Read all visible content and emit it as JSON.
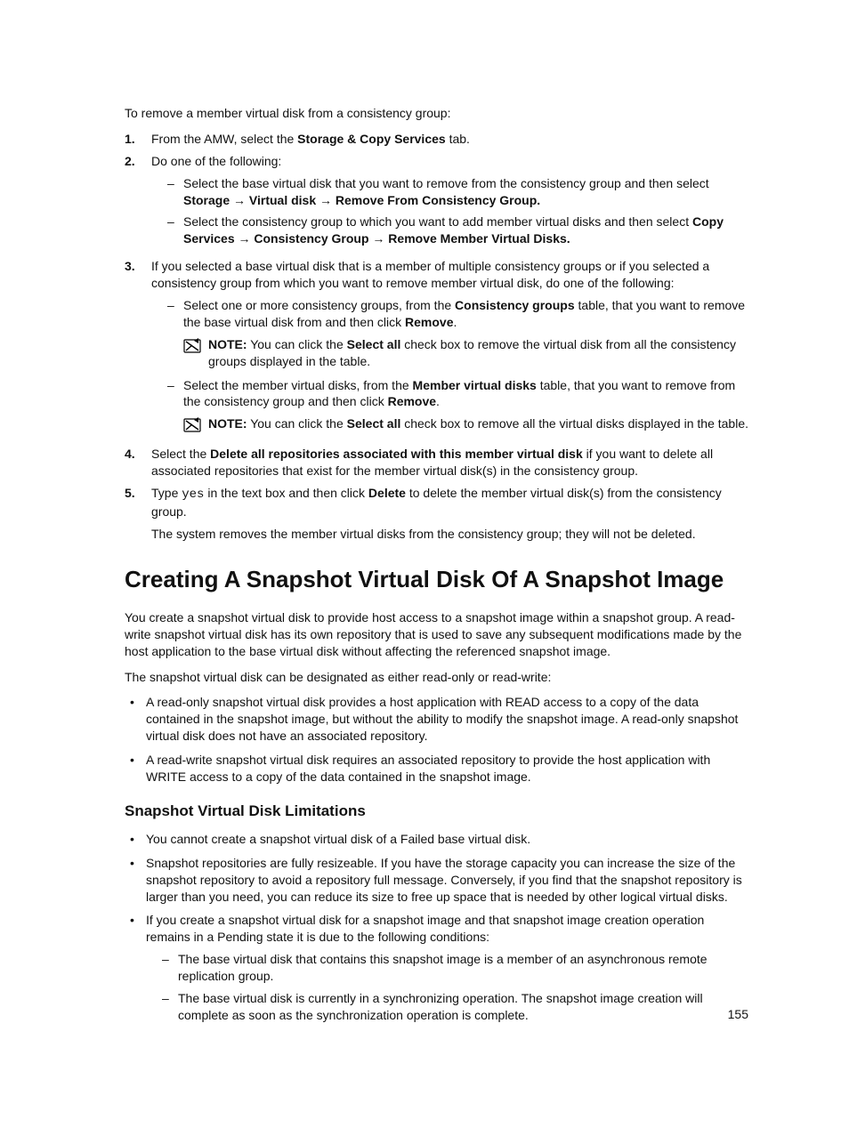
{
  "intro": "To remove a member virtual disk from a consistency group:",
  "steps": {
    "s1": {
      "num": "1.",
      "pre": "From the AMW, select the ",
      "bold": "Storage & Copy Services",
      "post": " tab."
    },
    "s2": {
      "num": "2.",
      "text": "Do one of the following:",
      "a": {
        "pre": "Select the base virtual disk that you want to remove from the consistency group and then select ",
        "bold": "Storage → Virtual disk → Remove From Consistency Group."
      },
      "b": {
        "pre": "Select the consistency group to which you want to add member virtual disks and then select ",
        "bold": "Copy Services → Consistency Group → Remove Member Virtual Disks."
      }
    },
    "s3": {
      "num": "3.",
      "text": "If you selected a base virtual disk that is a member of multiple consistency groups or if you selected a consistency group from which you want to remove member virtual disk, do one of the following:",
      "a": {
        "p1": "Select one or more consistency groups, from the ",
        "b1": "Consistency groups",
        "p2": " table, that you want to remove the base virtual disk from and then click ",
        "b2": "Remove",
        "p3": "."
      },
      "note_a": {
        "label": "NOTE:",
        "p1": " You can click the ",
        "b1": "Select all",
        "p2": " check box to remove the virtual disk from all the consistency groups displayed in the table."
      },
      "b": {
        "p1": "Select the member virtual disks, from the ",
        "b1": "Member virtual disks",
        "p2": " table, that you want to remove from the consistency group and then click ",
        "b2": "Remove",
        "p3": "."
      },
      "note_b": {
        "label": "NOTE:",
        "p1": " You can click the ",
        "b1": "Select all",
        "p2": " check box to remove all the virtual disks displayed in the table."
      }
    },
    "s4": {
      "num": "4.",
      "p1": "Select the ",
      "b1": "Delete all repositories associated with this member virtual disk",
      "p2": " if you want to delete all associated repositories that exist for the member virtual disk(s) in the consistency group."
    },
    "s5": {
      "num": "5.",
      "p1": "Type ",
      "mono": "yes",
      "p2": " in the text box and then click ",
      "b1": "Delete",
      "p3": " to delete the member virtual disk(s) from the consistency group.",
      "after": "The system removes the member virtual disks from the consistency group; they will not be deleted."
    }
  },
  "section": {
    "title": "Creating A Snapshot Virtual Disk Of A Snapshot Image",
    "para1": "You create a snapshot virtual disk to provide host access to a snapshot image within a snapshot group. A read-write snapshot virtual disk has its own repository that is used to save any subsequent modifications made by the host application to the base virtual disk without affecting the referenced snapshot image.",
    "para2": "The snapshot virtual disk can be designated as either read-only or read-write:",
    "bullets": {
      "i1": "A read-only snapshot virtual disk provides a host application with READ access to a copy of the data contained in the snapshot image, but without the ability to modify the snapshot image. A read-only snapshot virtual disk does not have an associated repository.",
      "i2": "A read-write snapshot virtual disk requires an associated repository to provide the host application with WRITE access to a copy of the data contained in the snapshot image."
    }
  },
  "sub": {
    "title": "Snapshot Virtual Disk Limitations",
    "bullets": {
      "i1": "You cannot create a snapshot virtual disk of a Failed base virtual disk.",
      "i2": "Snapshot repositories are fully resizeable. If you have the storage capacity you can increase the size of the snapshot repository to avoid a repository full message. Conversely, if you find that the snapshot repository is larger than you need, you can reduce its size to free up space that is needed by other logical virtual disks.",
      "i3": "If you create a snapshot virtual disk for a snapshot image and that snapshot image creation operation remains in a Pending state it is due to the following conditions:",
      "sub1": "The base virtual disk that contains this snapshot image is a member of an asynchronous remote replication group.",
      "sub2": "The base virtual disk is currently in a synchronizing operation. The snapshot image creation will complete as soon as the synchronization operation is complete."
    }
  },
  "pagenum": "155"
}
